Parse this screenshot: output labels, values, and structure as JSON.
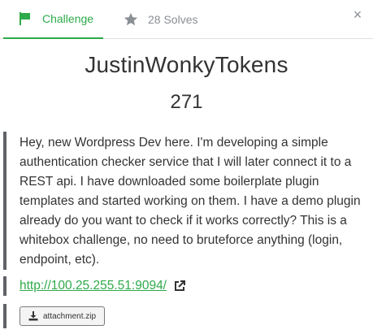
{
  "tabs": {
    "challenge_label": "Challenge",
    "solves_label": "28 Solves",
    "close_symbol": "×"
  },
  "challenge": {
    "name": "JustinWonkyTokens",
    "points": "271",
    "description": "Hey, new Wordpress Dev here. I'm developing a simple authentication checker service that I will later connect it to a REST api. I have downloaded some boilerplate plugin templates and started working on them. I have a demo plugin already do you want to check if it works correctly? This is a whitebox challenge, no need to bruteforce anything (login, endpoint, etc).",
    "link": "http://100.25.255.51:9094/",
    "attachment": "attachment.zip"
  },
  "colors": {
    "accent": "#2eaa4a",
    "muted": "#8a8f94",
    "quote_border": "#5f6266"
  },
  "icons": {
    "challenge_tab": "flag-icon",
    "solves_tab": "star-icon",
    "close": "close-icon",
    "link": "external-link-icon",
    "attachment": "download-icon"
  }
}
